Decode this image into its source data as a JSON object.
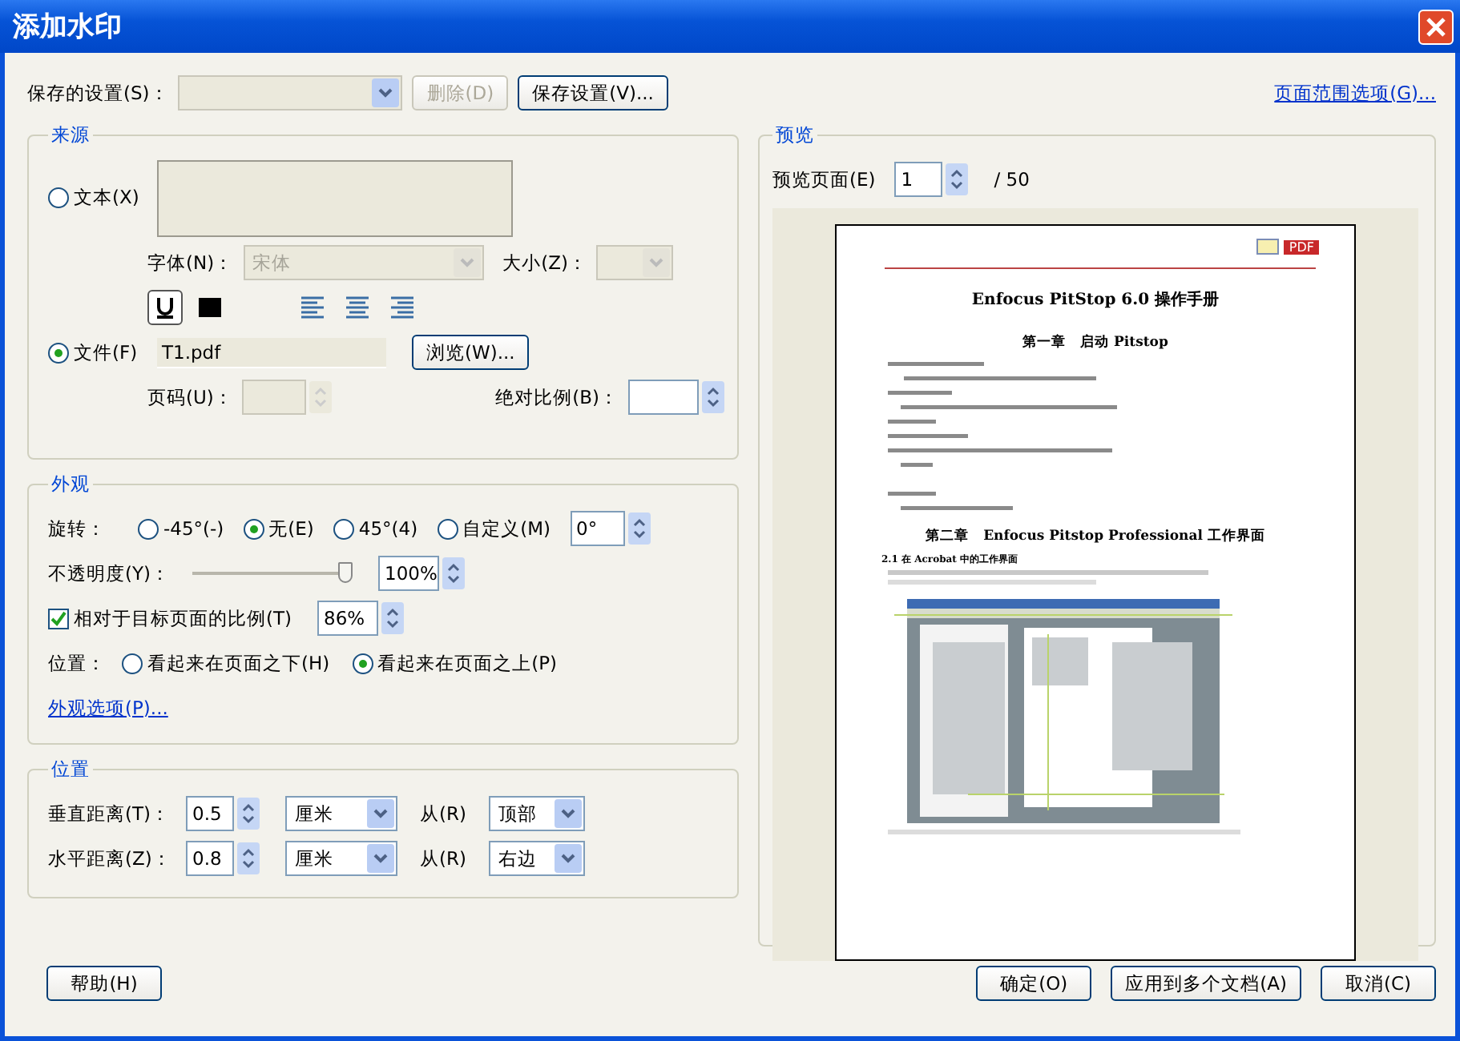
{
  "window": {
    "title": "添加水印"
  },
  "saved_settings": {
    "label": "保存的设置(S)：",
    "disabled": true,
    "delete_button": "删除(D)",
    "save_button": "保存设置(V)..."
  },
  "page_range_link": "页面范围选项(G)...",
  "source": {
    "title": "来源",
    "options": [
      {
        "kind": "text",
        "label": "文本(X)",
        "selected": false
      },
      {
        "kind": "file",
        "label": "文件(F)",
        "selected": true
      }
    ],
    "font_label": "字体(N)：",
    "font_value": "宋体",
    "size_label": "大小(Z)：",
    "file_value": "T1.pdf",
    "browse_button": "浏览(W)...",
    "page_label": "页码(U)：",
    "scale_label": "绝对比例(B)："
  },
  "appearance": {
    "title": "外观",
    "rotation_label": "旋转：",
    "rotations": [
      {
        "label": "-45°(-)",
        "selected": false
      },
      {
        "label": "无(E)",
        "selected": true
      },
      {
        "label": "45°(4)",
        "selected": false
      },
      {
        "label": "自定义(M)",
        "selected": false
      }
    ],
    "rotation_value": "0°",
    "opacity_label": "不透明度(Y)：",
    "opacity": {
      "level": 1.0
    },
    "opacity_value": "100%",
    "relative_scale": {
      "label": "相对于目标页面的比例(T)",
      "checked": true,
      "value": "86%"
    },
    "position_label": "位置：",
    "positions": [
      {
        "label": "看起来在页面之下(H)",
        "selected": false
      },
      {
        "label": "看起来在页面之上(P)",
        "selected": true
      }
    ],
    "options_link": "外观选项(P)..."
  },
  "position": {
    "title": "位置",
    "rows": [
      {
        "label": "垂直距离(T)：",
        "value": "0.5",
        "unit": "厘米",
        "from_label": "从(R)",
        "from": "顶部"
      },
      {
        "label": "水平距离(Z)：",
        "value": "0.8",
        "unit": "厘米",
        "from_label": "从(R)",
        "from": "右边"
      }
    ]
  },
  "preview": {
    "title": "预览",
    "page_label": "预览页面(E)",
    "page_value": "1",
    "page_total": "/ 50",
    "document": {
      "logo": "PDF",
      "title": "Enfocus PitStop 6.0 操作手册",
      "chapter_1": "第一章　启动 Pitstop",
      "chapter_2": "第二章　Enfocus Pitstop Professional 工作界面",
      "section": "2.1 在 Acrobat 中的工作界面"
    }
  },
  "help_button": "帮助(H)",
  "buttons": [
    "确定(O)",
    "应用到多个文档(A)",
    "取消(C)"
  ]
}
